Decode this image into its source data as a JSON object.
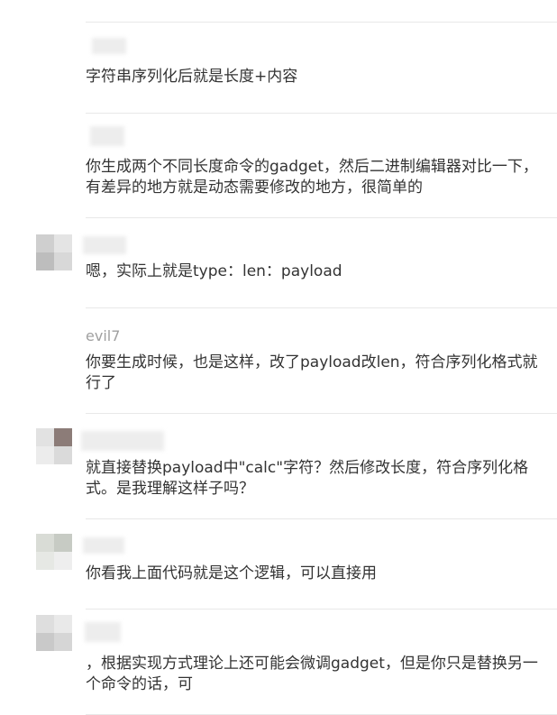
{
  "comments": [
    {
      "username": "",
      "text": "字符串序列化后就是长度+内容",
      "avatar": "blurred-avatar-icon"
    },
    {
      "username": "",
      "text": "你生成两个不同长度命令的gadget，然后二进制编辑器对比一下，有差异的地方就是动态需要修改的地方，很简单的",
      "avatar": "blurred-avatar-icon"
    },
    {
      "username": "",
      "text": "嗯，实际上就是type：len：payload",
      "avatar": "blurred-avatar-icon"
    },
    {
      "username": "evil7",
      "text": "你要生成时候，也是这样，改了payload改len，符合序列化格式就行了",
      "avatar": ""
    },
    {
      "username": "",
      "text": "就直接替换payload中\"calc\"字符？然后修改长度，符合序列化格式。是我理解这样子吗？",
      "avatar": "blurred-avatar-icon"
    },
    {
      "username": "",
      "text": "你看我上面代码就是这个逻辑，可以直接用",
      "avatar": "blurred-avatar-icon"
    },
    {
      "username": "",
      "text": "，根据实现方式理论上还可能会微调gadget，但是你只是替换另一个命令的话，可",
      "avatar": "blurred-avatar-icon"
    }
  ],
  "colors": {
    "text": "#333333",
    "username": "#a0a0a0",
    "divider": "#e8e8e8",
    "background": "#ffffff"
  }
}
